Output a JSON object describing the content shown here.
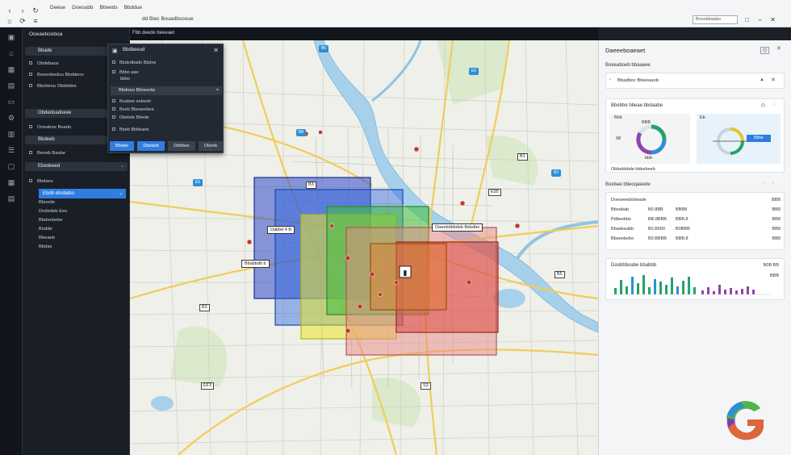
{
  "browser": {
    "menus": [
      "Deeue",
      "Doeoubb",
      "Bbeeds",
      "Bbddue"
    ],
    "address": "dd Biec Bouadbsooue",
    "search_placeholder": "Booobbaabo"
  },
  "sidebar": {
    "title": "Ooeaebooboa",
    "items": [
      {
        "type": "section",
        "label": "Bbade"
      },
      {
        "type": "item",
        "label": "Obdebaos"
      },
      {
        "type": "item",
        "label": "Boeeobeduu Bbddeno"
      },
      {
        "type": "item",
        "label": "Bbobeou Obdebbe"
      },
      {
        "type": "item",
        "label": "Obdedoadoeee"
      },
      {
        "type": "item",
        "label": "Ooeaboe Beado"
      },
      {
        "type": "section",
        "label": "Bbdeeb"
      },
      {
        "type": "item",
        "label": "Beoeb Baabe"
      },
      {
        "type": "section",
        "label": "Ebedeeed"
      },
      {
        "type": "item",
        "label": "Bbdaes"
      },
      {
        "type": "active",
        "label": "Ebdb ebobabo"
      },
      {
        "type": "item",
        "label": "Bboede"
      },
      {
        "type": "item",
        "label": "Dodedeb Eeu"
      },
      {
        "type": "item",
        "label": "Bbdeebebe"
      },
      {
        "type": "item",
        "label": "Bodde"
      },
      {
        "type": "item",
        "label": "Bbeaeb"
      },
      {
        "type": "item",
        "label": "Bbdas"
      }
    ]
  },
  "maptools": {
    "label": "Fbb deede beeeaet"
  },
  "dialog": {
    "title": "Bbdbeeud",
    "rows": [
      "Bbdedbade Bbdoe",
      "Bbbo aae",
      "bbbe",
      "Dbdeu Bbddade"
    ],
    "select": "Bbdeeo Bboeeda",
    "rows2": [
      "Boabee eebeeb",
      "Beeb Bbeaeebea",
      "Dbebde Bbede"
    ],
    "footer": "Bbeb Bbbbaeb",
    "buttons": [
      "Bbebe",
      "Dbebeb",
      "Dbbbee",
      "Dbeeb"
    ]
  },
  "map": {
    "routes": [
      "B5",
      "E5",
      "BB",
      "B3",
      "E5",
      "E95",
      "B3",
      "B5",
      "B3",
      "EF3",
      "S3",
      "B1"
    ],
    "zone_labels": [
      "Dabbd 4 B",
      "Bbabbdb b",
      "Oaeebdbbdeb Bebdbe"
    ],
    "zone_colors": [
      "#2d49c9",
      "#2f64e0",
      "#e7e52b",
      "#3fbf3a",
      "#d9352d",
      "#e98a88"
    ]
  },
  "panel": {
    "title": "Daeeeboaeaet",
    "section1": "Boeeaboeb bbaaeee",
    "input": "Bbadboc Bbeeaaob",
    "card1_title": "Bbebbe bbeae bbdaabe",
    "chart1": {
      "label_a": "Bbb",
      "label_b": "BBB",
      "label_c": "bbb",
      "value_a": "98",
      "value_b": "Eb",
      "button": "Bbbe"
    },
    "card2_link": "Obbebbbde bbbebeeb",
    "section2": "Boebae bbeoqaeede",
    "stats": [
      {
        "label": "Doeoeeebobeade",
        "a": "",
        "b": "",
        "c": "BBB"
      },
      {
        "label": "Bbeabab",
        "a": "B0.8BB",
        "b": "BBB8",
        "c": "BB8"
      },
      {
        "label": "Pdbeebbe",
        "a": "BB.8BBB",
        "b": "BBB.8",
        "c": "BB8"
      },
      {
        "label": "Bbadeeabb",
        "a": "B0.B000",
        "b": "B0BBB",
        "c": "BB8"
      },
      {
        "label": "Bbeeebebe",
        "a": "B0.BBBB",
        "b": "BBB.8",
        "c": "BB8"
      }
    ],
    "card3_title": "Doobbboabe bbabbb",
    "card3_values": [
      "B0B BB",
      "BBB"
    ],
    "bar_colors": [
      "#26a269",
      "#2d8fd6",
      "#8e44ad"
    ]
  },
  "bars": {
    "green": [
      8,
      18,
      10,
      22,
      14,
      24,
      9,
      19,
      16,
      12,
      21,
      10,
      17,
      22,
      9
    ],
    "purple": [
      5,
      9,
      4,
      12,
      6,
      8,
      5,
      7,
      10,
      6
    ]
  }
}
